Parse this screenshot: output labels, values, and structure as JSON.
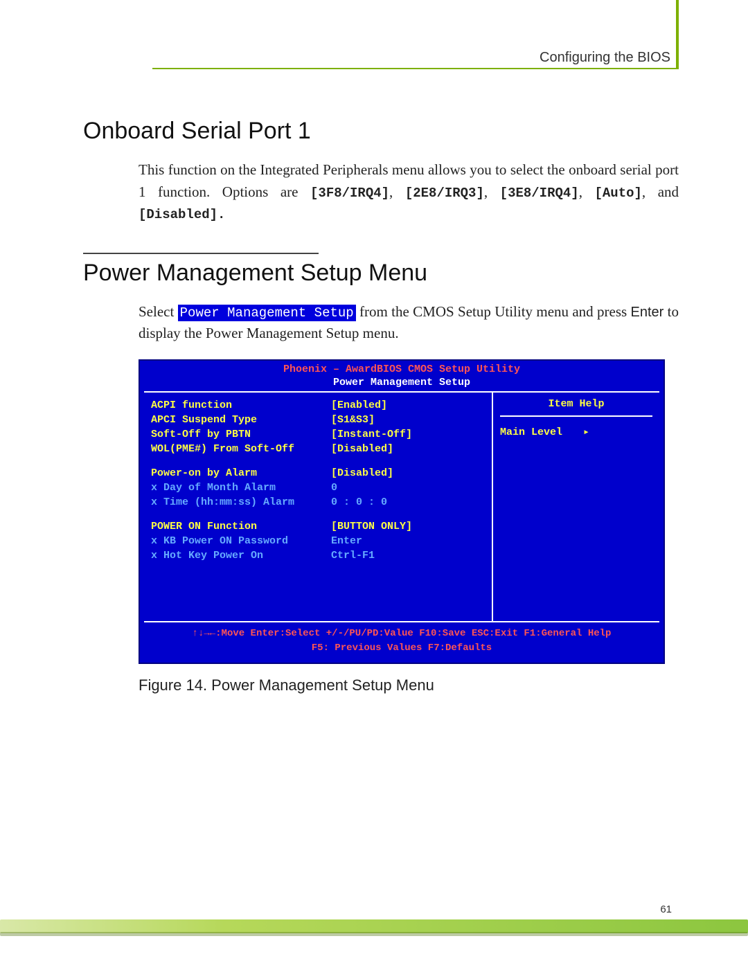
{
  "header": {
    "breadcrumb": "Configuring the BIOS"
  },
  "section1": {
    "title": "Onboard Serial Port 1",
    "para_lead": "This function on the Integrated Peripherals menu allows you to select the onboard serial port 1 function. Options are ",
    "opt1": "[3F8/IRQ4]",
    "sep1": ", ",
    "opt2": "[2E8/IRQ3]",
    "sep2": ", ",
    "opt3": "[3E8/IRQ4]",
    "sep3": ", ",
    "opt4": "[Auto]",
    "sep4": ", and ",
    "opt5": "[Disabled].",
    "period": ""
  },
  "section2": {
    "title": "Power Management Setup Menu",
    "para_a": "Select ",
    "highlight": "Power Management Setup",
    "para_b": " from the CMOS Setup Utility menu and press ",
    "enter": "Enter",
    "para_c": " to display the Power Management Setup menu."
  },
  "bios": {
    "title": "Phoenix – AwardBIOS CMOS Setup Utility",
    "subtitle": "Power Management Setup",
    "rows": {
      "r0l": "ACPI function",
      "r0v": "[Enabled]",
      "r1l": "APCI Suspend Type",
      "r1v": "[S1&S3]",
      "r2l": "Soft-Off by PBTN",
      "r2v": "[Instant-Off]",
      "r3l": "WOL(PME#) From Soft-Off",
      "r3v": "[Disabled]",
      "r4l": "Power-on by Alarm",
      "r4v": "[Disabled]",
      "r5l": "x Day of Month Alarm",
      "r5v": "  0",
      "r6l": "x Time (hh:mm:ss) Alarm",
      "r6v": " 0 : 0 : 0",
      "r7l": "POWER ON Function",
      "r7v": "[BUTTON ONLY]",
      "r8l": "x KB Power ON Password",
      "r8v": " Enter",
      "r9l": "x Hot Key Power On",
      "r9v": " Ctrl-F1"
    },
    "help_title": "Item Help",
    "mainlevel": "Main Level",
    "footer_line1": "↑↓→←:Move  Enter:Select  +/-/PU/PD:Value  F10:Save  ESC:Exit  F1:General Help",
    "footer_line2": "F5: Previous Values        F7:Defaults"
  },
  "figure": {
    "caption": "Figure 14.    Power Management Setup Menu"
  },
  "page_number": "61"
}
